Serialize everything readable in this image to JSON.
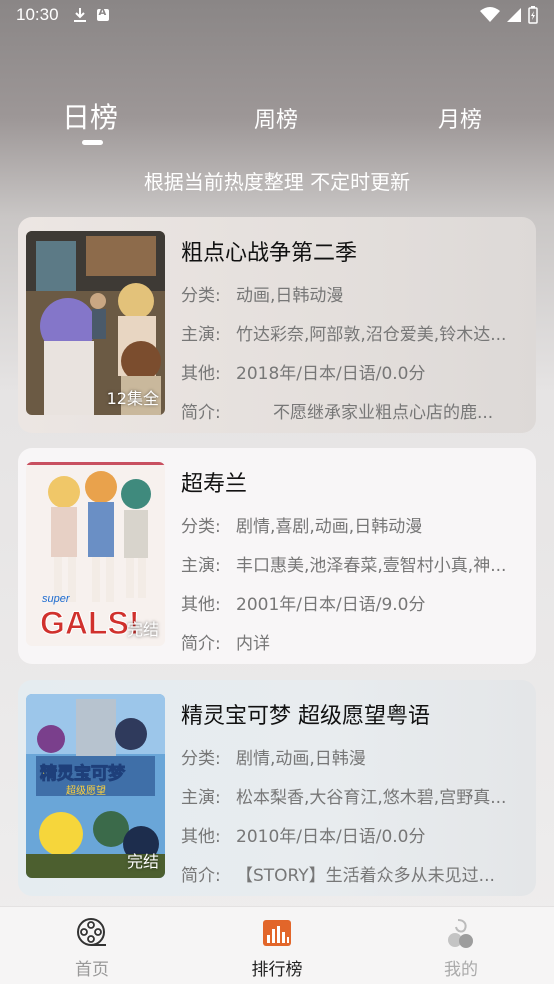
{
  "status_bar": {
    "time": "10:30"
  },
  "tabs": [
    {
      "label": "日榜",
      "active": true
    },
    {
      "label": "周榜",
      "active": false
    },
    {
      "label": "月榜",
      "active": false
    }
  ],
  "subtitle": "根据当前热度整理 不定时更新",
  "labels": {
    "category": "分类:",
    "cast": "主演:",
    "other": "其他:",
    "intro": "简介:"
  },
  "items": [
    {
      "title": "粗点心战争第二季",
      "badge": "12集全",
      "category": "动画,日韩动漫",
      "cast": "竹达彩奈,阿部敦,沼仓爱美,铃木达...",
      "other": "2018年/日本/日语/0.0分",
      "intro": "不愿继承家业粗点心店的鹿..."
    },
    {
      "title": "超寿兰",
      "badge": "完结",
      "category": "剧情,喜剧,动画,日韩动漫",
      "cast": "丰口惠美,池泽春菜,壹智村小真,神...",
      "other": "2001年/日本/日语/9.0分",
      "intro": "内详"
    },
    {
      "title": "精灵宝可梦 超级愿望粤语",
      "badge": "完结",
      "category": "剧情,动画,日韩漫",
      "cast": "松本梨香,大谷育江,悠木碧,宫野真...",
      "other": "2010年/日本/日语/0.0分",
      "intro": "【STORY】生活着众多从未见过..."
    }
  ],
  "poster_logos": {
    "item2": "GALS!",
    "item2_small": "super",
    "item3": "精灵宝可梦",
    "item3_sub": "超级愿望"
  },
  "bottom_nav": [
    {
      "label": "首页",
      "icon": "film-reel-icon"
    },
    {
      "label": "排行榜",
      "icon": "chart-icon",
      "active": true
    },
    {
      "label": "我的",
      "icon": "user-icon"
    }
  ],
  "colors": {
    "active_nav": "#e2662a",
    "tab_text": "#ffffff"
  }
}
